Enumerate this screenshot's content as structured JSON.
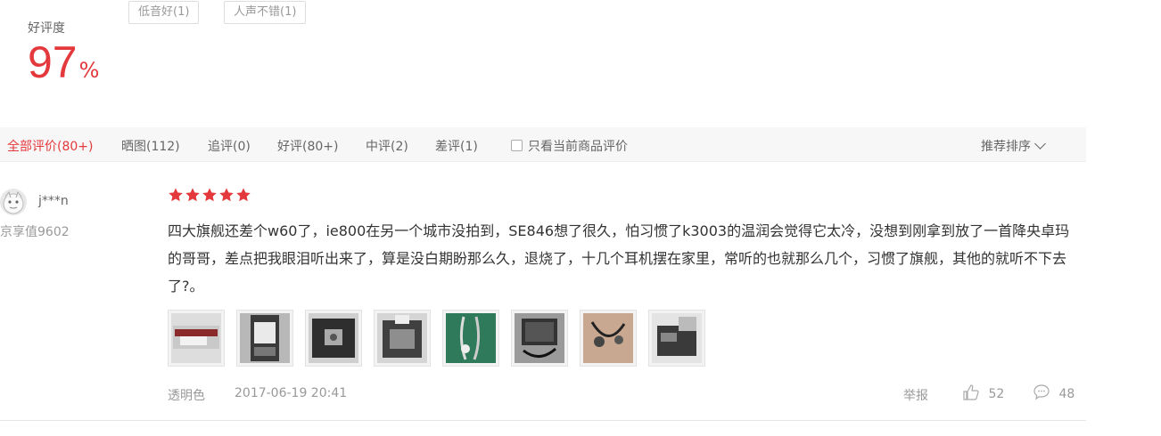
{
  "summary": {
    "label": "好评度",
    "rate": "97",
    "percent_sign": "%",
    "tags": [
      "低音好(1)",
      "人声不错(1)"
    ]
  },
  "tabs": [
    {
      "label": "全部评价(80+)",
      "active": true
    },
    {
      "label": "晒图(112)",
      "active": false
    },
    {
      "label": "追评(0)",
      "active": false
    },
    {
      "label": "好评(80+)",
      "active": false
    },
    {
      "label": "中评(2)",
      "active": false
    },
    {
      "label": "差评(1)",
      "active": false
    }
  ],
  "filter": {
    "only_current_label": "只看当前商品评价",
    "checked": false
  },
  "sort": {
    "label": "推荐排序"
  },
  "review": {
    "username": "j***n",
    "member_value": "京享值9602",
    "star_count": 5,
    "star_color": "#e4393c",
    "content": "四大旗舰还差个w60了，ie800在另一个城市没拍到，SE846想了很久，怕习惯了k3003的温润会觉得它太冷，没想到刚拿到放了一首降央卓玛的哥哥，差点把我眼泪听出来了，算是没白期盼那么久，退烧了，十几个耳机摆在家里，常听的也就那么几个，习惯了旗舰，其他的就听不下去了?。",
    "images": [
      {
        "icon": "product-photo-1"
      },
      {
        "icon": "product-photo-2"
      },
      {
        "icon": "product-photo-3"
      },
      {
        "icon": "product-photo-4"
      },
      {
        "icon": "product-photo-5"
      },
      {
        "icon": "product-photo-6"
      },
      {
        "icon": "product-photo-7"
      },
      {
        "icon": "product-photo-8"
      }
    ],
    "variant": "透明色",
    "datetime": "2017-06-19 20:41",
    "report_label": "举报",
    "likes": "52",
    "comments": "48"
  },
  "colors": {
    "accent": "#e4393c",
    "muted": "#999999"
  }
}
